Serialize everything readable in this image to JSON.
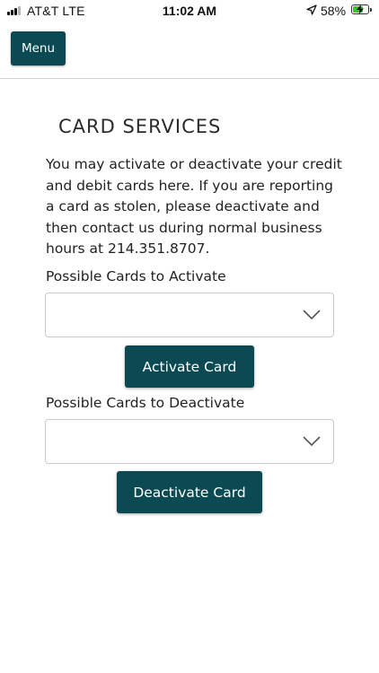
{
  "status_bar": {
    "carrier": "AT&T  LTE",
    "time": "11:02 AM",
    "battery_percent": "58%",
    "icons": [
      "signal-icon",
      "location-arrow-icon",
      "battery-charging-icon"
    ]
  },
  "header": {
    "menu_label": "Menu"
  },
  "page": {
    "title": "CARD SERVICES",
    "intro": "You may activate or deactivate your credit and debit cards here. If you are reporting a card as stolen, please deactivate and then contact us during normal business hours at 214.351.8707."
  },
  "activate": {
    "label": "Possible Cards to Activate",
    "selected": "",
    "button_label": "Activate Card"
  },
  "deactivate": {
    "label": "Possible Cards to Deactivate",
    "selected": "",
    "button_label": "Deactivate Card"
  },
  "colors": {
    "primary": "#0b4a52",
    "button_text": "#ffffff",
    "divider": "#cfcfcf"
  }
}
